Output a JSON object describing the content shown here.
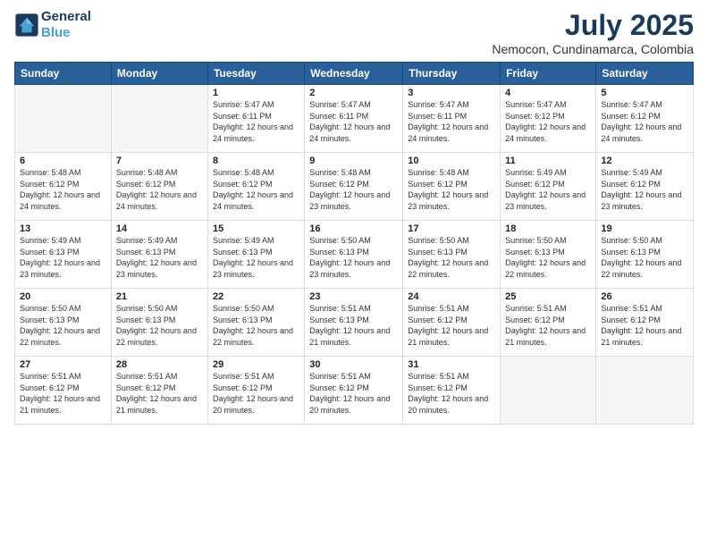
{
  "header": {
    "logo_line1": "General",
    "logo_line2": "Blue",
    "title": "July 2025",
    "subtitle": "Nemocon, Cundinamarca, Colombia"
  },
  "days_of_week": [
    "Sunday",
    "Monday",
    "Tuesday",
    "Wednesday",
    "Thursday",
    "Friday",
    "Saturday"
  ],
  "weeks": [
    [
      {
        "day": "",
        "info": ""
      },
      {
        "day": "",
        "info": ""
      },
      {
        "day": "1",
        "info": "Sunrise: 5:47 AM\nSunset: 6:11 PM\nDaylight: 12 hours and 24 minutes."
      },
      {
        "day": "2",
        "info": "Sunrise: 5:47 AM\nSunset: 6:11 PM\nDaylight: 12 hours and 24 minutes."
      },
      {
        "day": "3",
        "info": "Sunrise: 5:47 AM\nSunset: 6:11 PM\nDaylight: 12 hours and 24 minutes."
      },
      {
        "day": "4",
        "info": "Sunrise: 5:47 AM\nSunset: 6:12 PM\nDaylight: 12 hours and 24 minutes."
      },
      {
        "day": "5",
        "info": "Sunrise: 5:47 AM\nSunset: 6:12 PM\nDaylight: 12 hours and 24 minutes."
      }
    ],
    [
      {
        "day": "6",
        "info": "Sunrise: 5:48 AM\nSunset: 6:12 PM\nDaylight: 12 hours and 24 minutes."
      },
      {
        "day": "7",
        "info": "Sunrise: 5:48 AM\nSunset: 6:12 PM\nDaylight: 12 hours and 24 minutes."
      },
      {
        "day": "8",
        "info": "Sunrise: 5:48 AM\nSunset: 6:12 PM\nDaylight: 12 hours and 24 minutes."
      },
      {
        "day": "9",
        "info": "Sunrise: 5:48 AM\nSunset: 6:12 PM\nDaylight: 12 hours and 23 minutes."
      },
      {
        "day": "10",
        "info": "Sunrise: 5:48 AM\nSunset: 6:12 PM\nDaylight: 12 hours and 23 minutes."
      },
      {
        "day": "11",
        "info": "Sunrise: 5:49 AM\nSunset: 6:12 PM\nDaylight: 12 hours and 23 minutes."
      },
      {
        "day": "12",
        "info": "Sunrise: 5:49 AM\nSunset: 6:12 PM\nDaylight: 12 hours and 23 minutes."
      }
    ],
    [
      {
        "day": "13",
        "info": "Sunrise: 5:49 AM\nSunset: 6:13 PM\nDaylight: 12 hours and 23 minutes."
      },
      {
        "day": "14",
        "info": "Sunrise: 5:49 AM\nSunset: 6:13 PM\nDaylight: 12 hours and 23 minutes."
      },
      {
        "day": "15",
        "info": "Sunrise: 5:49 AM\nSunset: 6:13 PM\nDaylight: 12 hours and 23 minutes."
      },
      {
        "day": "16",
        "info": "Sunrise: 5:50 AM\nSunset: 6:13 PM\nDaylight: 12 hours and 23 minutes."
      },
      {
        "day": "17",
        "info": "Sunrise: 5:50 AM\nSunset: 6:13 PM\nDaylight: 12 hours and 22 minutes."
      },
      {
        "day": "18",
        "info": "Sunrise: 5:50 AM\nSunset: 6:13 PM\nDaylight: 12 hours and 22 minutes."
      },
      {
        "day": "19",
        "info": "Sunrise: 5:50 AM\nSunset: 6:13 PM\nDaylight: 12 hours and 22 minutes."
      }
    ],
    [
      {
        "day": "20",
        "info": "Sunrise: 5:50 AM\nSunset: 6:13 PM\nDaylight: 12 hours and 22 minutes."
      },
      {
        "day": "21",
        "info": "Sunrise: 5:50 AM\nSunset: 6:13 PM\nDaylight: 12 hours and 22 minutes."
      },
      {
        "day": "22",
        "info": "Sunrise: 5:50 AM\nSunset: 6:13 PM\nDaylight: 12 hours and 22 minutes."
      },
      {
        "day": "23",
        "info": "Sunrise: 5:51 AM\nSunset: 6:13 PM\nDaylight: 12 hours and 21 minutes."
      },
      {
        "day": "24",
        "info": "Sunrise: 5:51 AM\nSunset: 6:12 PM\nDaylight: 12 hours and 21 minutes."
      },
      {
        "day": "25",
        "info": "Sunrise: 5:51 AM\nSunset: 6:12 PM\nDaylight: 12 hours and 21 minutes."
      },
      {
        "day": "26",
        "info": "Sunrise: 5:51 AM\nSunset: 6:12 PM\nDaylight: 12 hours and 21 minutes."
      }
    ],
    [
      {
        "day": "27",
        "info": "Sunrise: 5:51 AM\nSunset: 6:12 PM\nDaylight: 12 hours and 21 minutes."
      },
      {
        "day": "28",
        "info": "Sunrise: 5:51 AM\nSunset: 6:12 PM\nDaylight: 12 hours and 21 minutes."
      },
      {
        "day": "29",
        "info": "Sunrise: 5:51 AM\nSunset: 6:12 PM\nDaylight: 12 hours and 20 minutes."
      },
      {
        "day": "30",
        "info": "Sunrise: 5:51 AM\nSunset: 6:12 PM\nDaylight: 12 hours and 20 minutes."
      },
      {
        "day": "31",
        "info": "Sunrise: 5:51 AM\nSunset: 6:12 PM\nDaylight: 12 hours and 20 minutes."
      },
      {
        "day": "",
        "info": ""
      },
      {
        "day": "",
        "info": ""
      }
    ]
  ]
}
